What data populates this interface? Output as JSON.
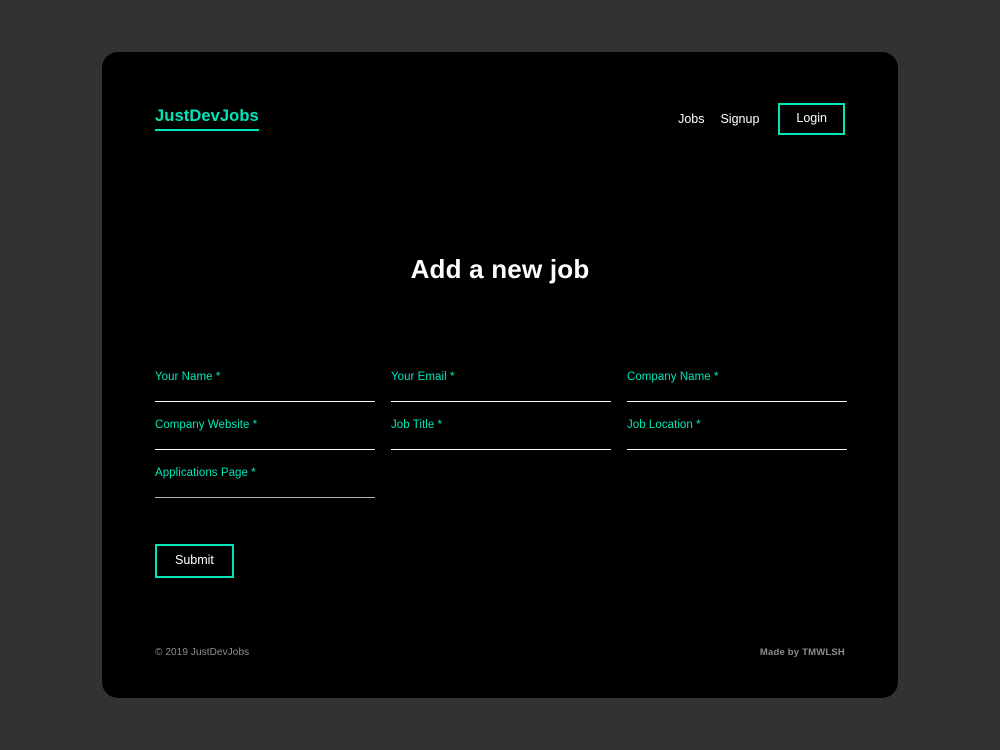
{
  "page": {
    "background_color": "#323232",
    "card_color": "#000000",
    "accent_color": "#00e6b8"
  },
  "header": {
    "brand": "JustDevJobs",
    "nav": [
      {
        "label": "Jobs",
        "name": "nav-link-jobs"
      },
      {
        "label": "Signup",
        "name": "nav-link-signup"
      }
    ],
    "login_label": "Login"
  },
  "main": {
    "heading": "Add a new job",
    "form": {
      "fields": [
        {
          "label": "Your Name",
          "required": "*",
          "value": "",
          "placeholder": "",
          "name": "your-name"
        },
        {
          "label": "Your Email",
          "required": "*",
          "value": "",
          "placeholder": "",
          "name": "your-email"
        },
        {
          "label": "Company Name",
          "required": "*",
          "value": "",
          "placeholder": "",
          "name": "company-name"
        },
        {
          "label": "Company Website",
          "required": "*",
          "value": "",
          "placeholder": "",
          "name": "company-website"
        },
        {
          "label": "Job Title",
          "required": "*",
          "value": "",
          "placeholder": "",
          "name": "job-title"
        },
        {
          "label": "Job Location",
          "required": "*",
          "value": "",
          "placeholder": "",
          "name": "job-location"
        },
        {
          "label": "Applications Page",
          "required": "*",
          "value": "",
          "placeholder": "",
          "name": "applications-page"
        }
      ],
      "submit_label": "Submit"
    }
  },
  "footer": {
    "copyright": "© 2019 JustDevJobs",
    "credit": "Made by TMWLSH"
  }
}
